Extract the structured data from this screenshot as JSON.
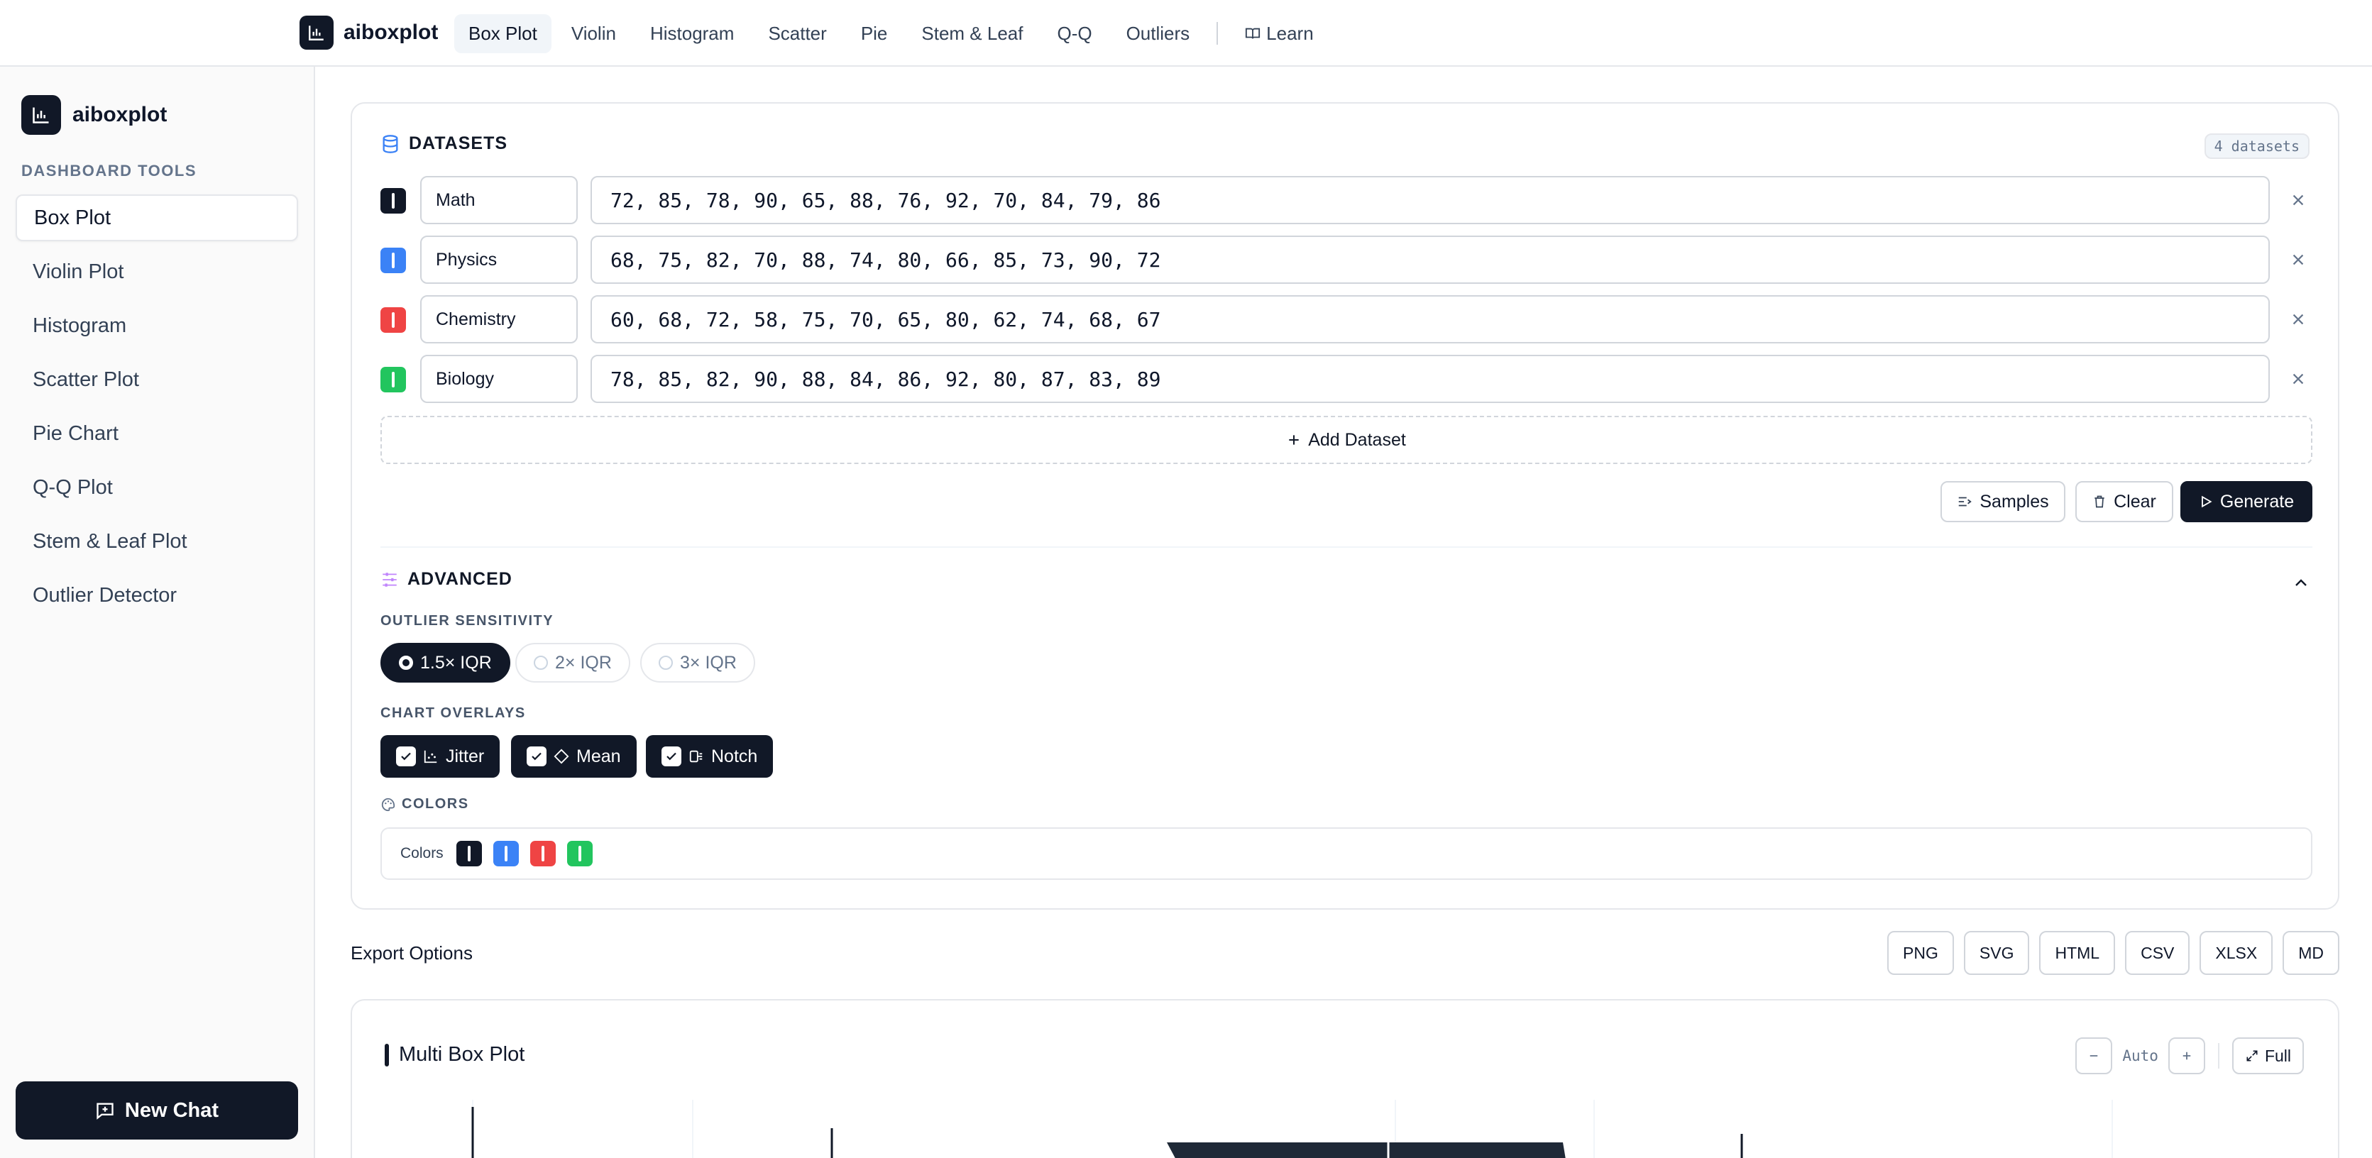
{
  "topbar": {
    "brand": "aiboxplot",
    "nav": [
      "Box Plot",
      "Violin",
      "Histogram",
      "Scatter",
      "Pie",
      "Stem & Leaf",
      "Q-Q",
      "Outliers"
    ],
    "learn": "Learn"
  },
  "sidebar": {
    "brand": "aiboxplot",
    "section": "DASHBOARD TOOLS",
    "items": [
      "Box Plot",
      "Violin Plot",
      "Histogram",
      "Scatter Plot",
      "Pie Chart",
      "Q-Q Plot",
      "Stem & Leaf Plot",
      "Outlier Detector"
    ],
    "new_chat": "New Chat"
  },
  "datasets": {
    "title": "DATASETS",
    "count": "4 datasets",
    "rows": [
      {
        "name": "Math",
        "values": "72, 85, 78, 90, 65, 88, 76, 92, 70, 84, 79, 86",
        "color": "#111827"
      },
      {
        "name": "Physics",
        "values": "68, 75, 82, 70, 88, 74, 80, 66, 85, 73, 90, 72",
        "color": "#3b82f6"
      },
      {
        "name": "Chemistry",
        "values": "60, 68, 72, 58, 75, 70, 65, 80, 62, 74, 68, 67",
        "color": "#ef4444"
      },
      {
        "name": "Biology",
        "values": "78, 85, 82, 90, 88, 84, 86, 92, 80, 87, 83, 89",
        "color": "#22c55e"
      }
    ],
    "add_label": "Add Dataset",
    "samples_label": "Samples",
    "clear_label": "Clear",
    "generate_label": "Generate"
  },
  "advanced": {
    "title": "ADVANCED",
    "sensitivity_label": "OUTLIER SENSITIVITY",
    "sensitivity_options": [
      "1.5× IQR",
      "2× IQR",
      "3× IQR"
    ],
    "sensitivity_selected": "1.5× IQR",
    "overlays_label": "CHART OVERLAYS",
    "overlays": [
      "Jitter",
      "Mean",
      "Notch"
    ],
    "overlays_checked": [
      true,
      true,
      true
    ],
    "colors_title": "COLORS",
    "colors_label": "Colors"
  },
  "export": {
    "title": "Export Options",
    "formats": [
      "PNG",
      "SVG",
      "HTML",
      "CSV",
      "XLSX",
      "MD"
    ]
  },
  "chart": {
    "title": "Multi Box Plot",
    "zoom_label": "Auto",
    "full_label": "Full"
  }
}
